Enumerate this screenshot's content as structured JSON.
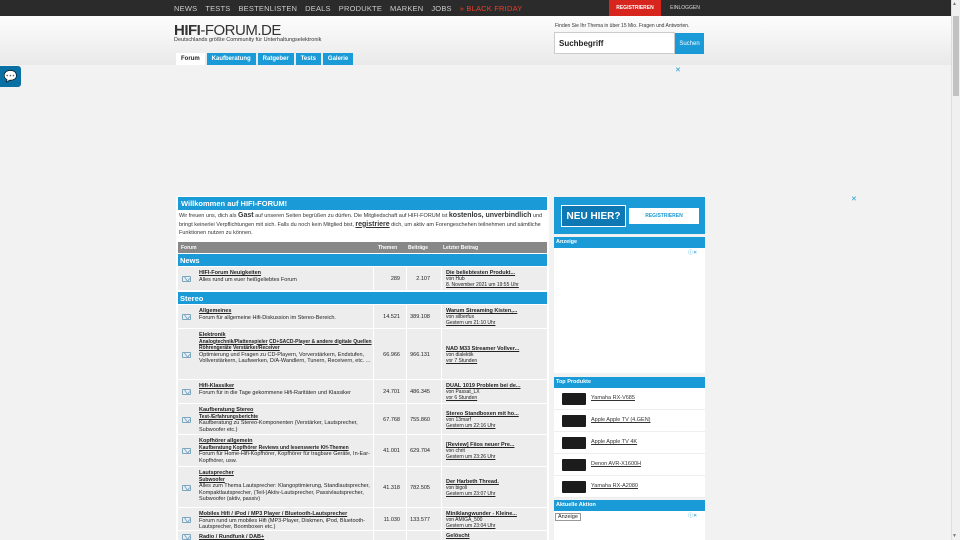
{
  "topnav": {
    "items": [
      "NEWS",
      "TESTS",
      "BESTENLISTEN",
      "DEALS",
      "PRODUKTE",
      "MARKEN",
      "JOBS",
      "» BLACK FRIDAY"
    ],
    "register": "REGISTRIEREN",
    "login": "EINLOGGEN"
  },
  "header": {
    "logo_bold": "HIFI",
    "logo_rest": "-FORUM.DE",
    "tagline": "Deutschlands größte Community für Unterhaltungselektronik",
    "search_hint": "Finden Sie Ihr Thema in über 15 Mio. Fragen und Antworten.",
    "search_placeholder": "Suchbegriff",
    "search_button": "Suchen"
  },
  "tabs": [
    "Forum",
    "Kaufberatung",
    "Ratgeber",
    "Tests",
    "Galerie"
  ],
  "ads": {
    "close": "✕",
    "adchoices": "ⓘ✕",
    "anzeige": "Anzeige"
  },
  "welcome": {
    "title": "Willkommen auf HIFI-FORUM!",
    "t1": "Wir freuen uns, dich als ",
    "b1": "Gast",
    "t2": " auf unseren Seiten begrüßen zu dürfen. Die Mitgliedschaft auf HIFI-FORUM ist ",
    "b2": "kostenlos, unverbindlich",
    "t3": " und bringt keinerlei Verpflichtungen mit sich. Falls du noch kein Mitglied bist, ",
    "b3": "registriere",
    "t4": " dich, um aktiv am Forengeschehen teilnehmen und sämtliche Funktionen nutzen zu können."
  },
  "table_head": {
    "forum": "Forum",
    "themen": "Themen",
    "beitraege": "Beiträge",
    "letzter": "Letzter Beitrag"
  },
  "sections": {
    "news": "News",
    "stereo": "Stereo"
  },
  "rows": [
    {
      "title": "HIFI-Forum Neuigkeiten",
      "subs": [],
      "desc": "Alles rund um euer heißgeliebtes Forum",
      "themen": "289",
      "beitraege": "2.107",
      "last_title": "Die beliebtesten Produkt...",
      "last_by": "von Hub",
      "last_when": "8. November 2021 um 19:55 Uhr"
    },
    {
      "title": "Allgemeines",
      "subs": [],
      "desc": "Forum für allgemeine Hifi-Diskussion im Stereo-Bereich.",
      "themen": "14.521",
      "beitraege": "389.108",
      "last_title": "Warum Streaming Kisten,...",
      "last_by": "von silberfux",
      "last_when": "Gestern um 21:10 Uhr"
    },
    {
      "title": "Elektronik",
      "subs": [
        "Analogtechnik/Plattenspieler",
        "CD+SACD-Player & andere digitale Quellen",
        "Röhrengeräte",
        "Verstärker/Receiver"
      ],
      "desc": "Optimierung und Fragen zu CD-Playern, Vorverstärkern, Endstufen, Vollverstärkern, Laufwerken, D/A-Wandlern, Tunern, Receivern, etc. ...",
      "themen": "66.966",
      "beitraege": "966.131",
      "last_title": "NAD M33 Streamer Vollver...",
      "last_by": "von dialektik",
      "last_when": "vor 7 Stunden"
    },
    {
      "title": "Hifi-Klassiker",
      "subs": [],
      "desc": "Forum für in die Tage gekommene Hifi-Raritäten und Klassiker",
      "themen": "24.701",
      "beitraege": "486.345",
      "last_title": "DUAL 1019 Problem bei de...",
      "last_by": "von Passat_LX",
      "last_when": "vor 6 Stunden"
    },
    {
      "title": "Kaufberatung Stereo",
      "subs": [
        "Test-/Erfahrungsberichte"
      ],
      "desc": "Kaufberatung zu Stereo-Komponenten (Verstärker, Lautsprecher, Subwoofer etc.)",
      "themen": "67.768",
      "beitraege": "755.860",
      "last_title": "Stereo Standboxen mit ho...",
      "last_by": "von 13marf",
      "last_when": "Gestern um 22:16 Uhr"
    },
    {
      "title": "Kopfhörer allgemein",
      "subs": [
        "Kaufberatung Kopfhörer",
        "Reviews und lesenswerte KH-Themen"
      ],
      "desc": "Forum für Home-Hifi-Kopfhörer, Kopfhörer für tragbare Geräte, In-Ear-Kopfhörer, usw.",
      "themen": "41.001",
      "beitraege": "629.704",
      "last_title": "[Review] Fiios neuer Pre...",
      "last_by": "von chrit",
      "last_when": "Gestern um 23:26 Uhr"
    },
    {
      "title": "Lautsprecher",
      "subs": [
        "Subwoofer"
      ],
      "desc": "Alles zum Thema Lautsprecher: Klangoptimierung, Standlautsprecher, Kompaktlautsprecher, (Teil-)Aktiv-Lautsprecher, Passivlautsprecher, Subwoofer (aktiv, passiv)",
      "themen": "41.318",
      "beitraege": "782.505",
      "last_title": "Der Harbeth Thread.",
      "last_by": "von bigoli",
      "last_when": "Gestern um 23:07 Uhr"
    },
    {
      "title": "Mobiles Hifi / iPod / MP3 Player / Bluetooth-Lautsprecher",
      "subs": [],
      "desc": "Forum rund um mobiles Hifi (MP3-Player, Diskmen, iPod, Bluetooth-Lautsprecher, Boomboxen etc.)",
      "themen": "11.030",
      "beitraege": "133.577",
      "last_title": "Miniklangwunder - Kleine...",
      "last_by": "von AMIGA_500",
      "last_when": "Gestern um 23:04 Uhr"
    },
    {
      "title": "Radio / Rundfunk / DAB+",
      "subs": [],
      "desc": "",
      "themen": "",
      "beitraege": "",
      "last_title": "Gelöscht",
      "last_by": "",
      "last_when": ""
    }
  ],
  "sidebar": {
    "new_here": "NEU HIER?",
    "register": "REGISTRIEREN",
    "anzeige": "Anzeige",
    "top_products": "Top Produkte",
    "products": [
      "Yamaha RX-V685",
      "Apple Apple TV (4.GEN)",
      "Apple Apple TV 4K",
      "Denon AVR-X1600H",
      "Yamaha RX-A2080"
    ],
    "current_action": "Aktuelle Aktion"
  }
}
